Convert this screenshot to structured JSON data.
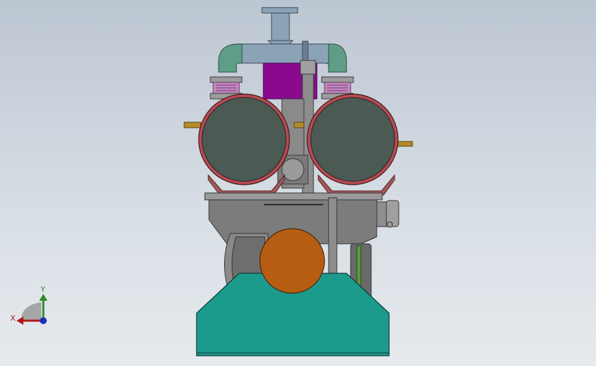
{
  "triad": {
    "y_label": "Y",
    "x_label": "X",
    "colors": {
      "y": "#2a8a2a",
      "x": "#b01818",
      "z": "#1c2fbf"
    }
  },
  "colors": {
    "base": "#1c9b8c",
    "dome": "#b55e13",
    "panel": "#8a0a8e",
    "tank": "#4c5a54",
    "tank_rim": "#b84a52",
    "pipe": "#8aa3b7",
    "elbow": "#5f9e86",
    "steel": "#7c7c7c"
  }
}
